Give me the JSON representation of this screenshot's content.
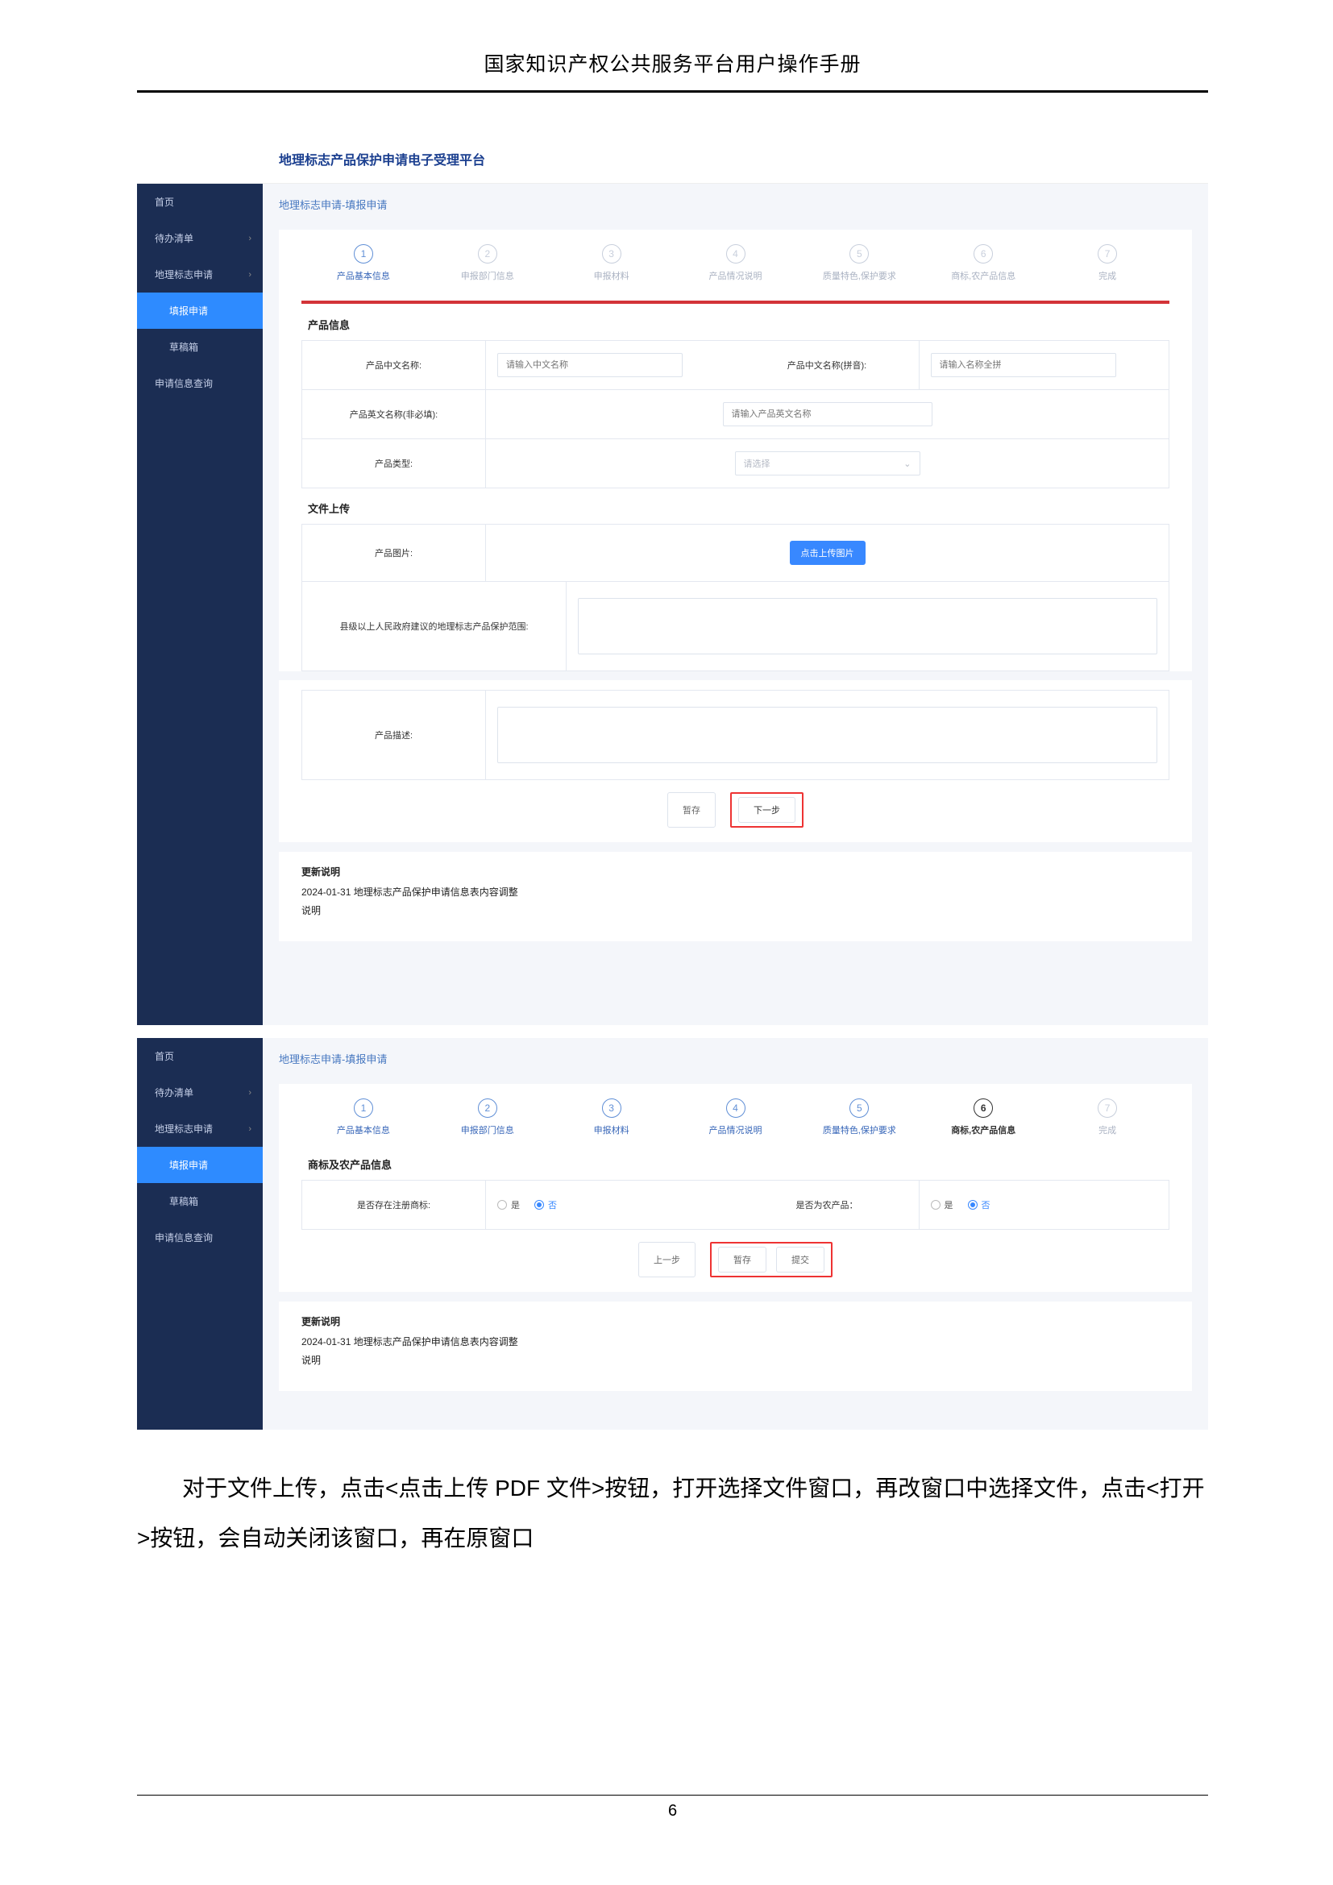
{
  "document": {
    "header_title": "国家知识产权公共服务平台用户操作手册",
    "page_number": "6"
  },
  "body_paragraph": "对于文件上传，点击<点击上传 PDF 文件>按钮，打开选择文件窗口，再改窗口中选择文件，点击<打开>按钮，会自动关闭该窗口，再在原窗口",
  "screenshot1": {
    "platform_title": "地理标志产品保护申请电子受理平台",
    "sidebar": {
      "items": [
        {
          "label": "首页",
          "chev": ""
        },
        {
          "label": "待办清单",
          "chev": "›"
        },
        {
          "label": "地理标志申请",
          "chev": "›"
        }
      ],
      "sub_items": [
        {
          "label": "填报申请"
        },
        {
          "label": "草稿箱"
        }
      ],
      "footer_item": {
        "label": "申请信息查询"
      }
    },
    "view_title": "地理标志申请-填报申请",
    "steps": [
      "产品基本信息",
      "申报部门信息",
      "申报材料",
      "产品情况说明",
      "质量特色,保护要求",
      "商标,农产品信息",
      "完成"
    ],
    "section_product_info": "产品信息",
    "fields": {
      "cn_name_label": "产品中文名称:",
      "cn_name_placeholder": "请输入中文名称",
      "cn_pinyin_label": "产品中文名称(拼音):",
      "cn_pinyin_placeholder": "请输入名称全拼",
      "en_name_label": "产品英文名称(非必填):",
      "en_name_placeholder": "请输入产品英文名称",
      "type_label": "产品类型:",
      "type_placeholder": "请选择"
    },
    "section_upload": "文件上传",
    "upload": {
      "image_label": "产品图片:",
      "upload_btn": "点击上传图片",
      "scope_label": "县级以上人民政府建议的地理标志产品保护范围:"
    },
    "desc_label": "产品描述:",
    "buttons": {
      "save": "暂存",
      "next": "下一步"
    },
    "update_note": {
      "title": "更新说明",
      "line1": "2024-01-31 地理标志产品保护申请信息表内容调整",
      "line2": "说明"
    }
  },
  "screenshot2": {
    "sidebar": {
      "items": [
        {
          "label": "首页",
          "chev": ""
        },
        {
          "label": "待办清单",
          "chev": "›"
        },
        {
          "label": "地理标志申请",
          "chev": "›"
        }
      ],
      "sub_items": [
        {
          "label": "填报申请"
        },
        {
          "label": "草稿箱"
        }
      ],
      "footer_item": {
        "label": "申请信息查询"
      }
    },
    "view_title": "地理标志申请-填报申请",
    "steps": [
      "产品基本信息",
      "申报部门信息",
      "申报材料",
      "产品情况说明",
      "质量特色,保护要求",
      "商标,农产品信息",
      "完成"
    ],
    "section_label": "商标及农产品信息",
    "q1_label": "是否存在注册商标:",
    "q2_label": "是否为农产品：",
    "radio_yes": "是",
    "radio_no": "否",
    "buttons": {
      "prev": "上一步",
      "save": "暂存",
      "submit": "提交"
    },
    "update_note": {
      "title": "更新说明",
      "line1": "2024-01-31 地理标志产品保护申请信息表内容调整",
      "line2": "说明"
    }
  }
}
